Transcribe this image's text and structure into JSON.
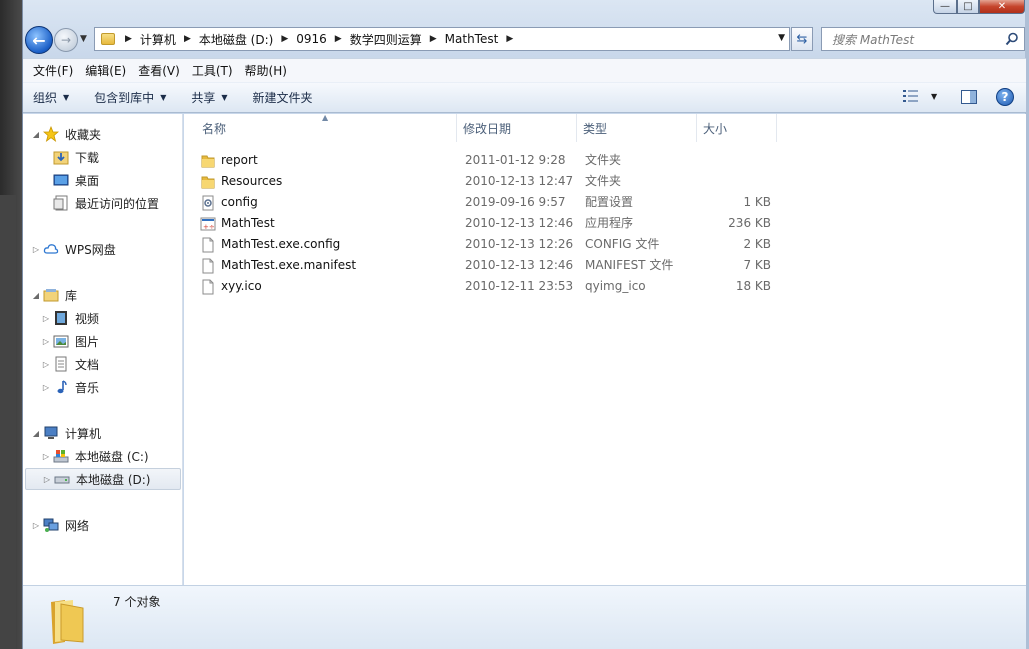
{
  "address": {
    "crumbs": [
      "计算机",
      "本地磁盘 (D:)",
      "0916",
      "数学四则运算",
      "MathTest"
    ]
  },
  "search": {
    "placeholder": "搜索 MathTest"
  },
  "menu": [
    "文件(F)",
    "编辑(E)",
    "查看(V)",
    "工具(T)",
    "帮助(H)"
  ],
  "toolbar": {
    "organize": "组织",
    "include_library": "包含到库中",
    "share": "共享",
    "new_folder": "新建文件夹"
  },
  "nav": {
    "favorites": "收藏夹",
    "downloads": "下载",
    "desktop": "桌面",
    "recent": "最近访问的位置",
    "wps": "WPS网盘",
    "libraries": "库",
    "videos": "视频",
    "pictures": "图片",
    "documents": "文档",
    "music": "音乐",
    "computer": "计算机",
    "drive_c": "本地磁盘 (C:)",
    "drive_d": "本地磁盘 (D:)",
    "network": "网络"
  },
  "columns": {
    "name": "名称",
    "date": "修改日期",
    "type": "类型",
    "size": "大小"
  },
  "files": [
    {
      "name": "report",
      "date": "2011-01-12 9:28",
      "type": "文件夹",
      "size": "",
      "icon": "folder-icon"
    },
    {
      "name": "Resources",
      "date": "2010-12-13 12:47",
      "type": "文件夹",
      "size": "",
      "icon": "folder-icon"
    },
    {
      "name": "config",
      "date": "2019-09-16 9:57",
      "type": "配置设置",
      "size": "1 KB",
      "icon": "config-file-icon"
    },
    {
      "name": "MathTest",
      "date": "2010-12-13 12:46",
      "type": "应用程序",
      "size": "236 KB",
      "icon": "application-icon"
    },
    {
      "name": "MathTest.exe.config",
      "date": "2010-12-13 12:26",
      "type": "CONFIG 文件",
      "size": "2 KB",
      "icon": "file-icon"
    },
    {
      "name": "MathTest.exe.manifest",
      "date": "2010-12-13 12:46",
      "type": "MANIFEST 文件",
      "size": "7 KB",
      "icon": "file-icon"
    },
    {
      "name": "xyy.ico",
      "date": "2010-12-11 23:53",
      "type": "qyimg_ico",
      "size": "18 KB",
      "icon": "file-icon"
    }
  ],
  "status": {
    "count": "7 个对象"
  },
  "colors": {
    "accent": "#1a5fc7",
    "folder": "#e7b93d"
  }
}
